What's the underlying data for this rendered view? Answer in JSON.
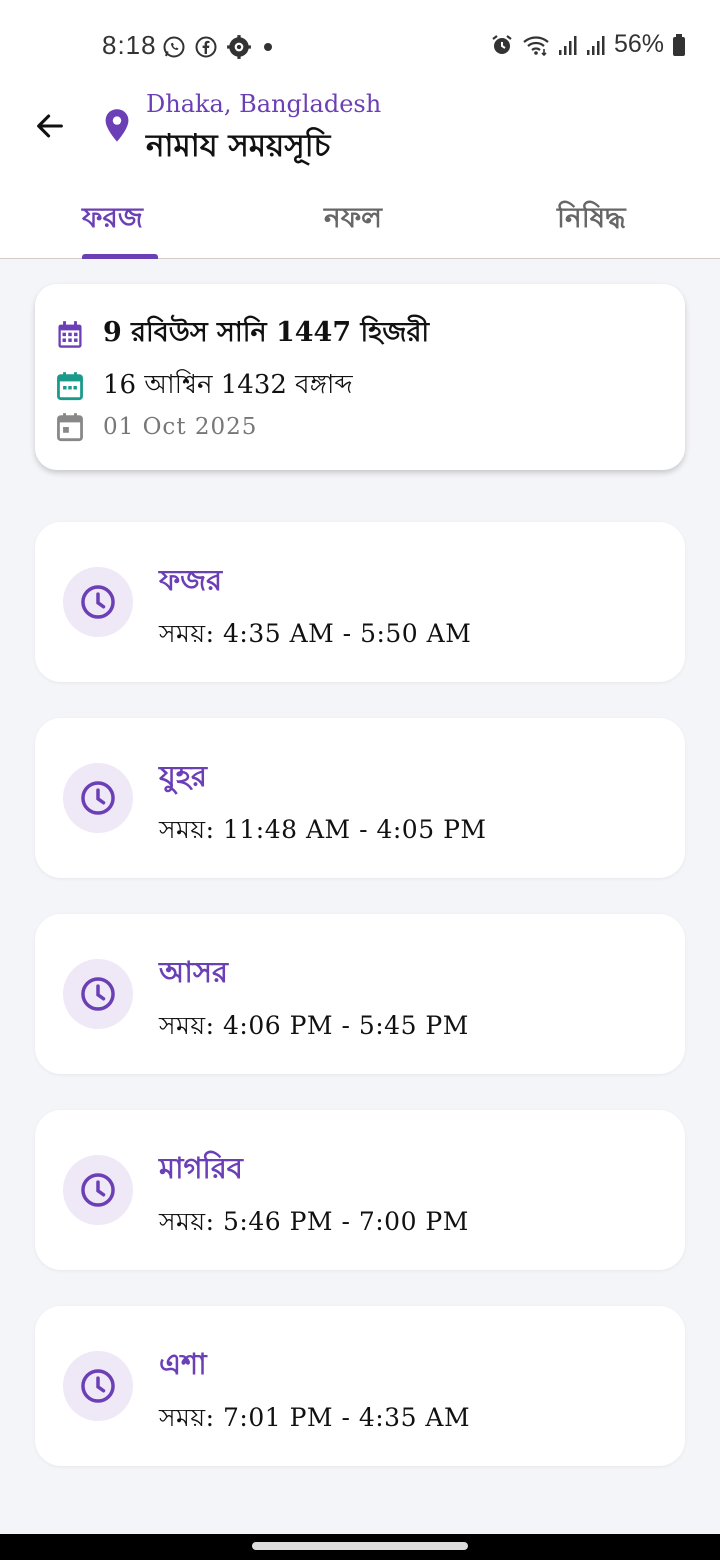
{
  "status_bar": {
    "time": "8:18",
    "battery": "56%",
    "icons": [
      "whatsapp-icon",
      "facebook-icon",
      "gear-notification-icon",
      "dot-icon",
      "alarm-icon",
      "wifi-icon",
      "signal-icon",
      "signal-icon",
      "battery-icon"
    ]
  },
  "header": {
    "location": "Dhaka, Bangladesh",
    "title": "নামায সময়সূচি"
  },
  "tabs": [
    {
      "label": "ফরজ",
      "active": true
    },
    {
      "label": "নফল",
      "active": false
    },
    {
      "label": "নিষিদ্ধ",
      "active": false
    }
  ],
  "dates": {
    "hijri": "9 রবিউস সানি 1447 হিজরী",
    "bangla": "16 আশ্বিন 1432 বঙ্গাব্দ",
    "gregorian": "01 Oct 2025"
  },
  "prayers": [
    {
      "name": "ফজর",
      "time": "সময়: 4:35 AM - 5:50 AM"
    },
    {
      "name": "যুহর",
      "time": "সময়: 11:48 AM - 4:05 PM"
    },
    {
      "name": "আসর",
      "time": "সময়: 4:06 PM - 5:45 PM"
    },
    {
      "name": "মাগরিব",
      "time": "সময়: 5:46 PM - 7:00 PM"
    },
    {
      "name": "এশা",
      "time": "সময়: 7:01 PM - 4:35 AM"
    }
  ],
  "colors": {
    "accent": "#6b3fb6",
    "badge_bg": "#efe8f6",
    "bangla_calendar_icon": "#1a9a8a",
    "background": "#f4f5f9"
  }
}
